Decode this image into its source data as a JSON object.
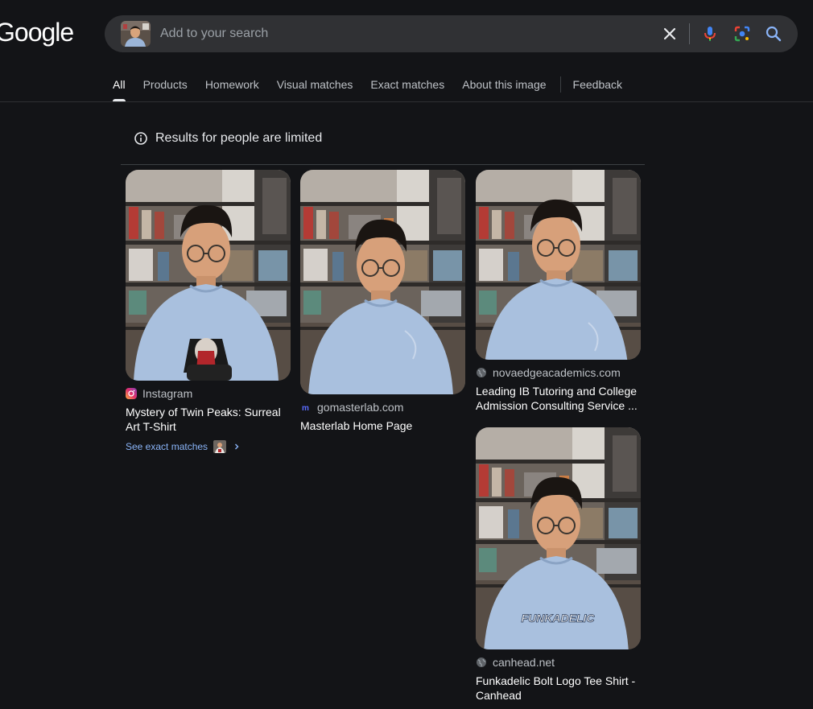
{
  "logo": "Google",
  "search": {
    "placeholder": "Add to your search",
    "value": ""
  },
  "tabs": [
    {
      "label": "All",
      "active": true
    },
    {
      "label": "Products"
    },
    {
      "label": "Homework"
    },
    {
      "label": "Visual matches"
    },
    {
      "label": "Exact matches"
    },
    {
      "label": "About this image"
    },
    {
      "label": "Feedback"
    }
  ],
  "notice": {
    "text": "Results for people are limited"
  },
  "results": [
    {
      "source": "Instagram",
      "source_icon": "instagram-icon",
      "title_line1": "Mystery of Twin Peaks: Surreal",
      "title_line2": "Art T-Shirt",
      "exact_label": "See exact matches"
    },
    {
      "source": "gomasterlab.com",
      "source_icon": "masterlab-icon",
      "title_line1": "Masterlab Home Page"
    },
    {
      "source": "novaedgeacademics.com",
      "source_icon": "globe-icon",
      "title_line1": "Leading IB Tutoring and College",
      "title_line2": "Admission Consulting Service ..."
    },
    {
      "source": "canhead.net",
      "source_icon": "globe-icon",
      "title_line1": "Funkadelic Bolt Logo Tee Shirt -",
      "title_line2": "Canhead",
      "shirt_text": "FUNKADELIC"
    }
  ],
  "colors": {
    "background": "#131417",
    "searchbar": "#303134",
    "link": "#8ab4f8"
  }
}
